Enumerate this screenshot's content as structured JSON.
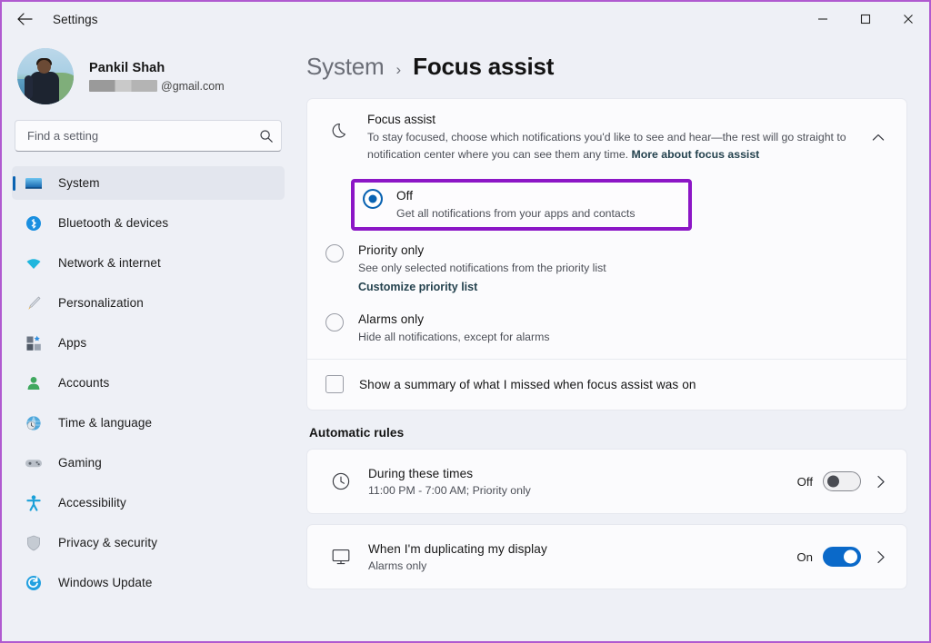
{
  "window": {
    "title": "Settings",
    "back_icon": "arrow-left-icon",
    "minimize_label": "—",
    "maximize_label": "☐",
    "close_label": "✕"
  },
  "profile": {
    "name": "Pankil Shah",
    "email_suffix": "@gmail.com",
    "email_redacted": true
  },
  "search": {
    "placeholder": "Find a setting",
    "value": "",
    "icon": "search-icon"
  },
  "sidebar": {
    "items": [
      {
        "label": "System",
        "icon": "monitor-icon",
        "active": true
      },
      {
        "label": "Bluetooth & devices",
        "icon": "bluetooth-icon",
        "active": false
      },
      {
        "label": "Network & internet",
        "icon": "wifi-icon",
        "active": false
      },
      {
        "label": "Personalization",
        "icon": "paintbrush-icon",
        "active": false
      },
      {
        "label": "Apps",
        "icon": "apps-icon",
        "active": false
      },
      {
        "label": "Accounts",
        "icon": "person-icon",
        "active": false
      },
      {
        "label": "Time & language",
        "icon": "globe-clock-icon",
        "active": false
      },
      {
        "label": "Gaming",
        "icon": "gamepad-icon",
        "active": false
      },
      {
        "label": "Accessibility",
        "icon": "accessibility-icon",
        "active": false
      },
      {
        "label": "Privacy & security",
        "icon": "shield-icon",
        "active": false
      },
      {
        "label": "Windows Update",
        "icon": "update-icon",
        "active": false
      }
    ]
  },
  "breadcrumb": {
    "parent": "System",
    "separator": "›",
    "current": "Focus assist"
  },
  "focus_assist": {
    "icon": "moon-icon",
    "title": "Focus assist",
    "description": "To stay focused, choose which notifications you'd like to see and hear—the rest will go straight to notification center where you can see them any time.",
    "link": "More about focus assist",
    "collapse_icon": "chevron-up-icon",
    "options": [
      {
        "label": "Off",
        "sub": "Get all notifications from your apps and contacts",
        "selected": true,
        "highlighted": true,
        "link": ""
      },
      {
        "label": "Priority only",
        "sub": "See only selected notifications from the priority list",
        "selected": false,
        "highlighted": false,
        "link": "Customize priority list"
      },
      {
        "label": "Alarms only",
        "sub": "Hide all notifications, except for alarms",
        "selected": false,
        "highlighted": false,
        "link": ""
      }
    ],
    "summary_checkbox": {
      "label": "Show a summary of what I missed when focus assist was on",
      "checked": false
    }
  },
  "automatic_rules": {
    "title": "Automatic rules",
    "rules": [
      {
        "icon": "clock-icon",
        "title": "During these times",
        "sub": "11:00 PM - 7:00 AM; Priority only",
        "state": "Off",
        "on": false,
        "chevron": "chevron-right-icon"
      },
      {
        "icon": "monitor-icon",
        "title": "When I'm duplicating my display",
        "sub": "Alarms only",
        "state": "On",
        "on": true,
        "chevron": "chevron-right-icon"
      }
    ]
  },
  "colors": {
    "accent": "#0a63b2",
    "annotation": "#8c16c6",
    "toggle_on": "#0a69c9",
    "window_bg": "#eef0f6",
    "card_bg": "#fbfbfd",
    "frame_border": "#b05ad0"
  }
}
